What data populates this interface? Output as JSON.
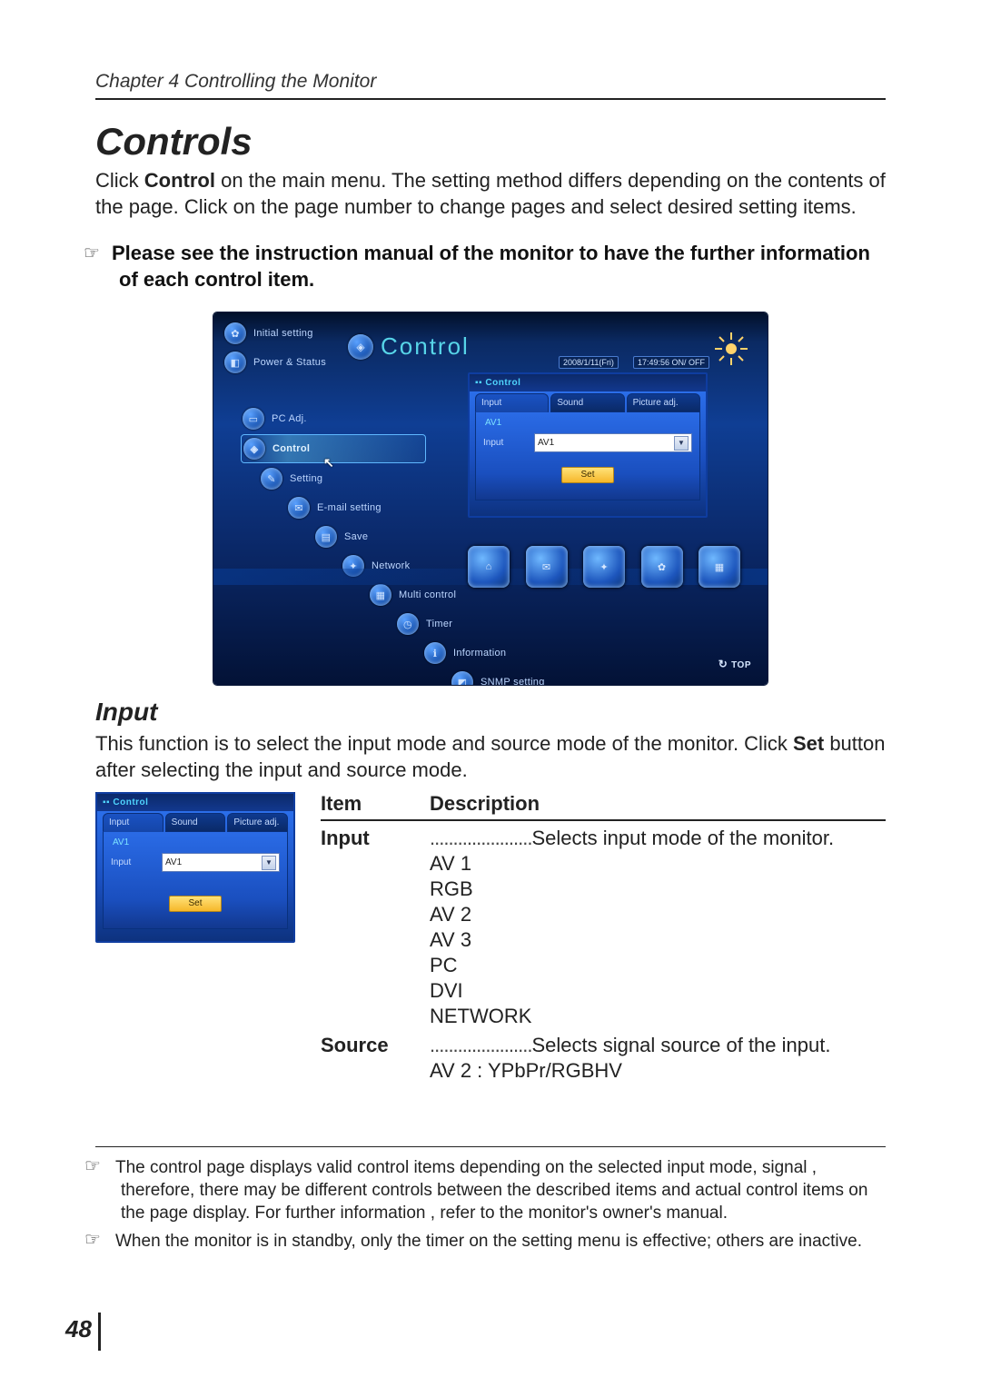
{
  "header": {
    "chapter": "Chapter 4 Controlling the Monitor"
  },
  "section": {
    "title": "Controls",
    "intro_a": "Click ",
    "intro_bold": "Control",
    "intro_b": " on the main menu. The setting method differs depending on the contents of the page. Click on the page number to change pages and select desired setting items.",
    "note": "Please see the instruction manual of the monitor to have the further information of each control item."
  },
  "shot": {
    "title": "Control",
    "date": "2008/1/11(Fri)",
    "time": "17:49:56  ON/ OFF",
    "menu": [
      {
        "label": "Initial setting",
        "indent": 0
      },
      {
        "label": "Power & Status",
        "indent": 0
      },
      {
        "label": "PC Adj.",
        "indent": 1
      },
      {
        "label": "Control",
        "indent": 1,
        "active": true
      },
      {
        "label": "Setting",
        "indent": 2
      },
      {
        "label": "E-mail setting",
        "indent": 3
      },
      {
        "label": "Save",
        "indent": 4
      },
      {
        "label": "Network",
        "indent": 5
      },
      {
        "label": "Multi control",
        "indent": 6
      },
      {
        "label": "Timer",
        "indent": 7
      },
      {
        "label": "Information",
        "indent": 8
      },
      {
        "label": "SNMP setting",
        "indent": 9
      }
    ],
    "panel": {
      "title": "Control",
      "tabs": [
        "Input",
        "Sound",
        "Picture adj."
      ],
      "sub": "AV1",
      "field_label": "Input",
      "field_value": "AV1",
      "set": "Set"
    },
    "top_link": "TOP"
  },
  "input": {
    "title": "Input",
    "intro_a": "This function is to select the input mode and source mode of the monitor.  Click ",
    "intro_bold": "Set",
    "intro_b": " button after selecting the input and source mode.",
    "mini": {
      "title": "Control",
      "tabs": [
        "Input",
        "Sound",
        "Picture adj."
      ],
      "sub": "AV1",
      "field_label": "Input",
      "field_value": "AV1",
      "set": "Set"
    },
    "table": {
      "head_item": "Item",
      "head_desc": "Description",
      "rows": [
        {
          "item": "Input",
          "desc": "Selects input mode of the monitor.",
          "options": [
            "AV 1",
            "RGB",
            "AV 2",
            "AV 3",
            "PC",
            "DVI",
            "NETWORK"
          ]
        },
        {
          "item": "Source",
          "desc": "Selects signal source of the input.",
          "options": [
            "AV 2 : YPbPr/RGBHV"
          ]
        }
      ]
    }
  },
  "footnotes": [
    "The control page displays valid control items depending on the selected input mode, signal , therefore, there may be different controls between the described items and actual control items on the page display. For further information , refer to the monitor's owner's manual.",
    "When the monitor is in standby, only the timer on the setting menu is effective; others are inactive."
  ],
  "page_number": "48"
}
